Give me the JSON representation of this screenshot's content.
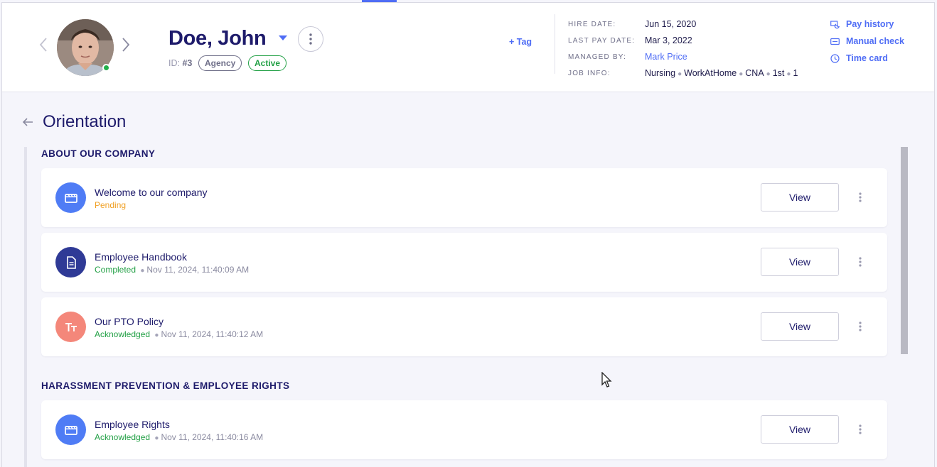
{
  "employee": {
    "name": "Doe, John",
    "id_label": "ID:",
    "id_value": "#3",
    "tags": [
      "Agency",
      "Active"
    ],
    "add_tag": "+ Tag",
    "online": true
  },
  "info": {
    "hire_date_label": "HIRE DATE:",
    "hire_date": "Jun 15, 2020",
    "last_pay_label": "LAST PAY DATE:",
    "last_pay": "Mar 3, 2022",
    "managed_by_label": "MANAGED BY:",
    "managed_by": "Mark Price",
    "job_info_label": "JOB INFO:",
    "job_info": [
      "Nursing",
      "WorkAtHome",
      "CNA",
      "1st",
      "1"
    ]
  },
  "side_links": {
    "pay_history": "Pay history",
    "manual_check": "Manual check",
    "time_card": "Time card"
  },
  "page": {
    "title": "Orientation"
  },
  "sections": [
    {
      "title": "ABOUT OUR COMPANY",
      "items": [
        {
          "title": "Welcome to our company",
          "status": "Pending",
          "timestamp": "",
          "icon": "video-icon",
          "icon_color": "#4f7cf5",
          "button": "View"
        },
        {
          "title": "Employee Handbook",
          "status": "Completed",
          "timestamp": "Nov 11, 2024, 11:40:09 AM",
          "icon": "document-icon",
          "icon_color": "#2f3a96",
          "button": "View"
        },
        {
          "title": "Our PTO Policy",
          "status": "Acknowledged",
          "timestamp": "Nov 11, 2024, 11:40:12 AM",
          "icon": "text-icon",
          "icon_color": "#f4877a",
          "button": "View"
        }
      ]
    },
    {
      "title": "HARASSMENT PREVENTION & EMPLOYEE RIGHTS",
      "items": [
        {
          "title": "Employee Rights",
          "status": "Acknowledged",
          "timestamp": "Nov 11, 2024, 11:40:16 AM",
          "icon": "video-icon",
          "icon_color": "#4f7cf5",
          "button": "View"
        }
      ]
    }
  ],
  "colors": {
    "accent": "#4f6df5",
    "title": "#1e1b6b",
    "success": "#22a045",
    "pending": "#f0a024"
  }
}
